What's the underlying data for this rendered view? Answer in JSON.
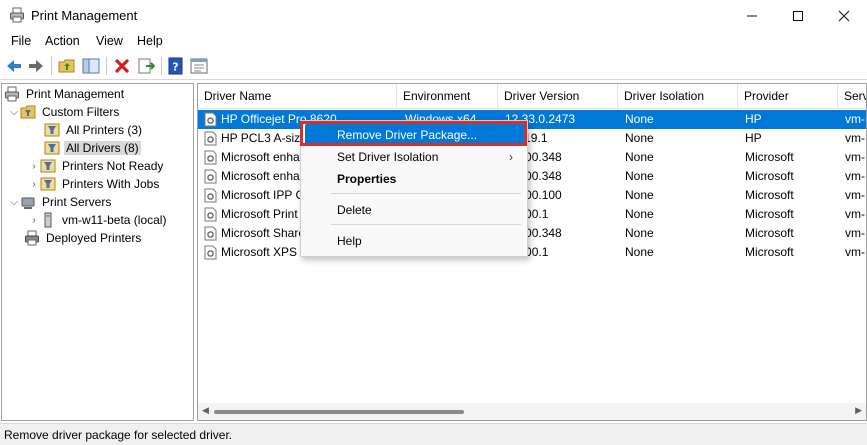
{
  "window": {
    "title": "Print Management"
  },
  "menubar": {
    "items": [
      "File",
      "Action",
      "View",
      "Help"
    ]
  },
  "toolbar": {
    "buttons": [
      "back-icon",
      "forward-icon",
      "up-folder-icon",
      "show-hide-tree-icon",
      "delete-icon",
      "export-list-icon",
      "help-icon",
      "properties-icon"
    ]
  },
  "tree": {
    "root": "Print Management",
    "custom_filters": "Custom Filters",
    "all_printers": "All Printers (3)",
    "all_drivers": "All Drivers (8)",
    "printers_not_ready": "Printers Not Ready",
    "printers_with_jobs": "Printers With Jobs",
    "print_servers": "Print Servers",
    "server_name": "vm-w11-beta (local)",
    "deployed_printers": "Deployed Printers"
  },
  "table": {
    "columns": [
      "Driver Name",
      "Environment",
      "Driver Version",
      "Driver Isolation",
      "Provider",
      "Serv"
    ],
    "rows": [
      [
        "HP Officejet Pro 8620",
        "Windows x64",
        "12.33.0.2473",
        "None",
        "HP",
        "vm-"
      ],
      [
        "HP PCL3 A-size",
        "",
        "17119.1",
        "None",
        "HP",
        "vm-"
      ],
      [
        "Microsoft enha",
        "",
        "22000.348",
        "None",
        "Microsoft",
        "vm-"
      ],
      [
        "Microsoft enha",
        "",
        "22000.348",
        "None",
        "Microsoft",
        "vm-"
      ],
      [
        "Microsoft IPP C",
        "",
        "22000.100",
        "None",
        "Microsoft",
        "vm-"
      ],
      [
        "Microsoft Print",
        "",
        "22000.1",
        "None",
        "Microsoft",
        "vm-"
      ],
      [
        "Microsoft Share",
        "",
        "22000.348",
        "None",
        "Microsoft",
        "vm-"
      ],
      [
        "Microsoft XPS",
        "",
        "22000.1",
        "None",
        "Microsoft",
        "vm-"
      ]
    ]
  },
  "context_menu": {
    "remove": "Remove Driver Package...",
    "isolation": "Set Driver Isolation",
    "isolation_arrow": "›",
    "properties": "Properties",
    "delete": "Delete",
    "help": "Help"
  },
  "status": {
    "text": "Remove driver package for selected driver."
  },
  "colors": {
    "selection": "#0078d7",
    "highlight_box": "#d0312d"
  }
}
